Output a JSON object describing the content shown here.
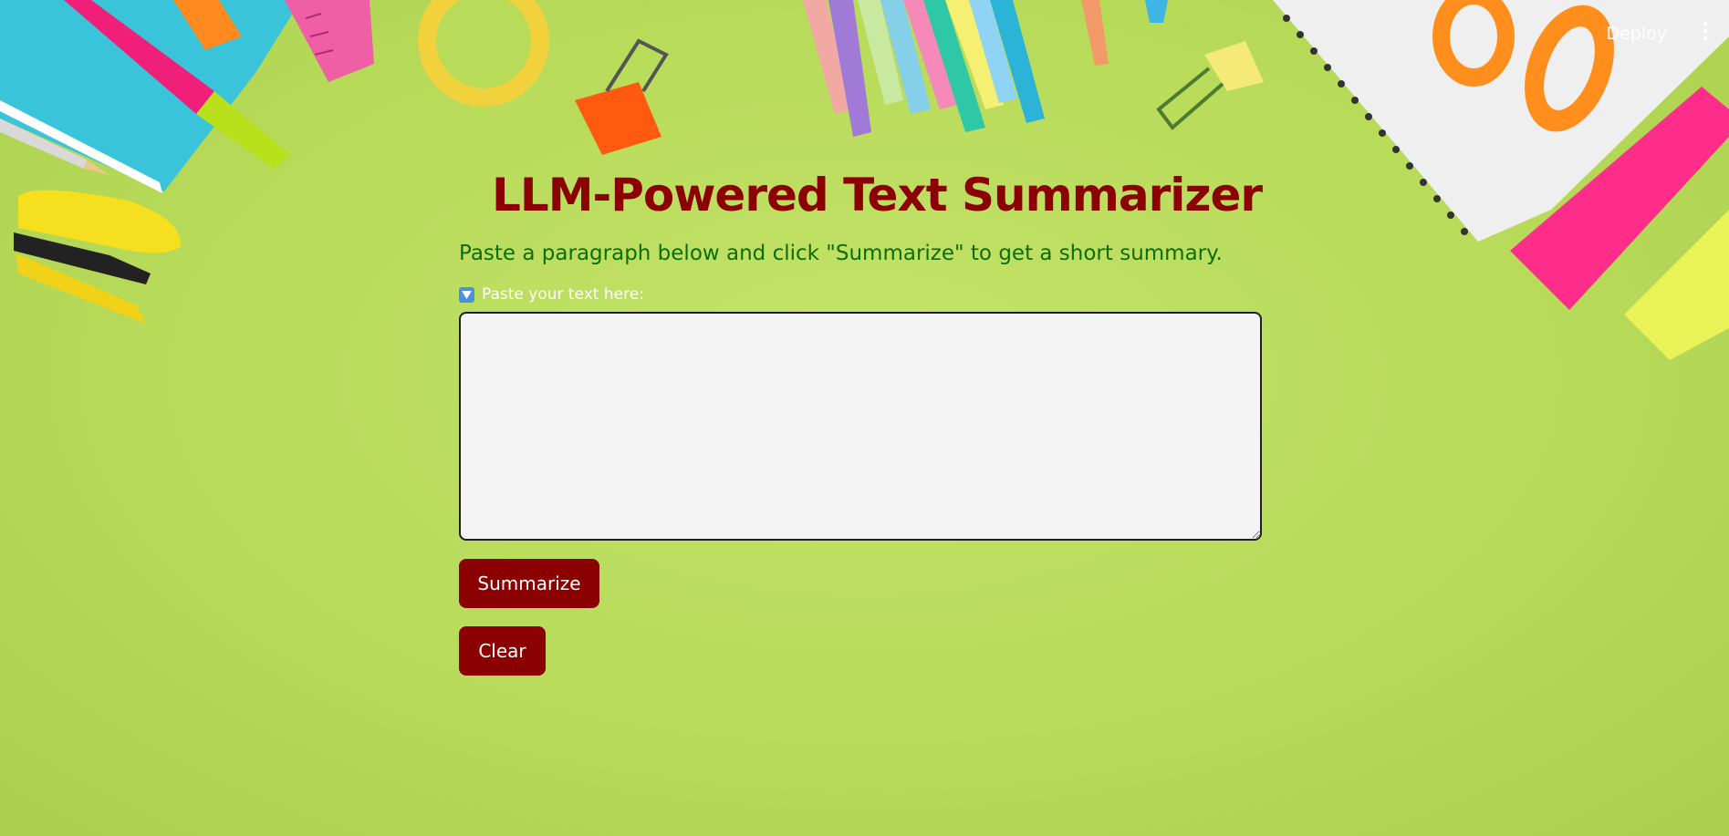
{
  "header": {
    "deploy_label": "Deploy",
    "menu_icon": "more-vertical-icon"
  },
  "main": {
    "title_icon": "memo-pencil-icon",
    "title": "LLM-Powered Text Summarizer",
    "subtitle": "Paste a paragraph below and click \"Summarize\" to get a short summary.",
    "input_label_icon": "down-arrow-box-icon",
    "input_label": "Paste your text here:",
    "input_value": "",
    "summarize_label": "Summarize",
    "clear_label": "Clear"
  },
  "background_icons": [
    "notebook-icon",
    "ruler-icon",
    "tape-icon",
    "paper-clip-icon",
    "binder-clip-icon",
    "colored-pencils-icon",
    "stapler-icon",
    "pencil-icon",
    "spiral-notebook-icon",
    "scissors-icon",
    "highlighter-icon"
  ],
  "colors": {
    "background": "#b8db5a",
    "title": "#8b0000",
    "subtitle": "#0b6e00",
    "button": "#8b0000",
    "textarea": "#f4f4f4"
  }
}
